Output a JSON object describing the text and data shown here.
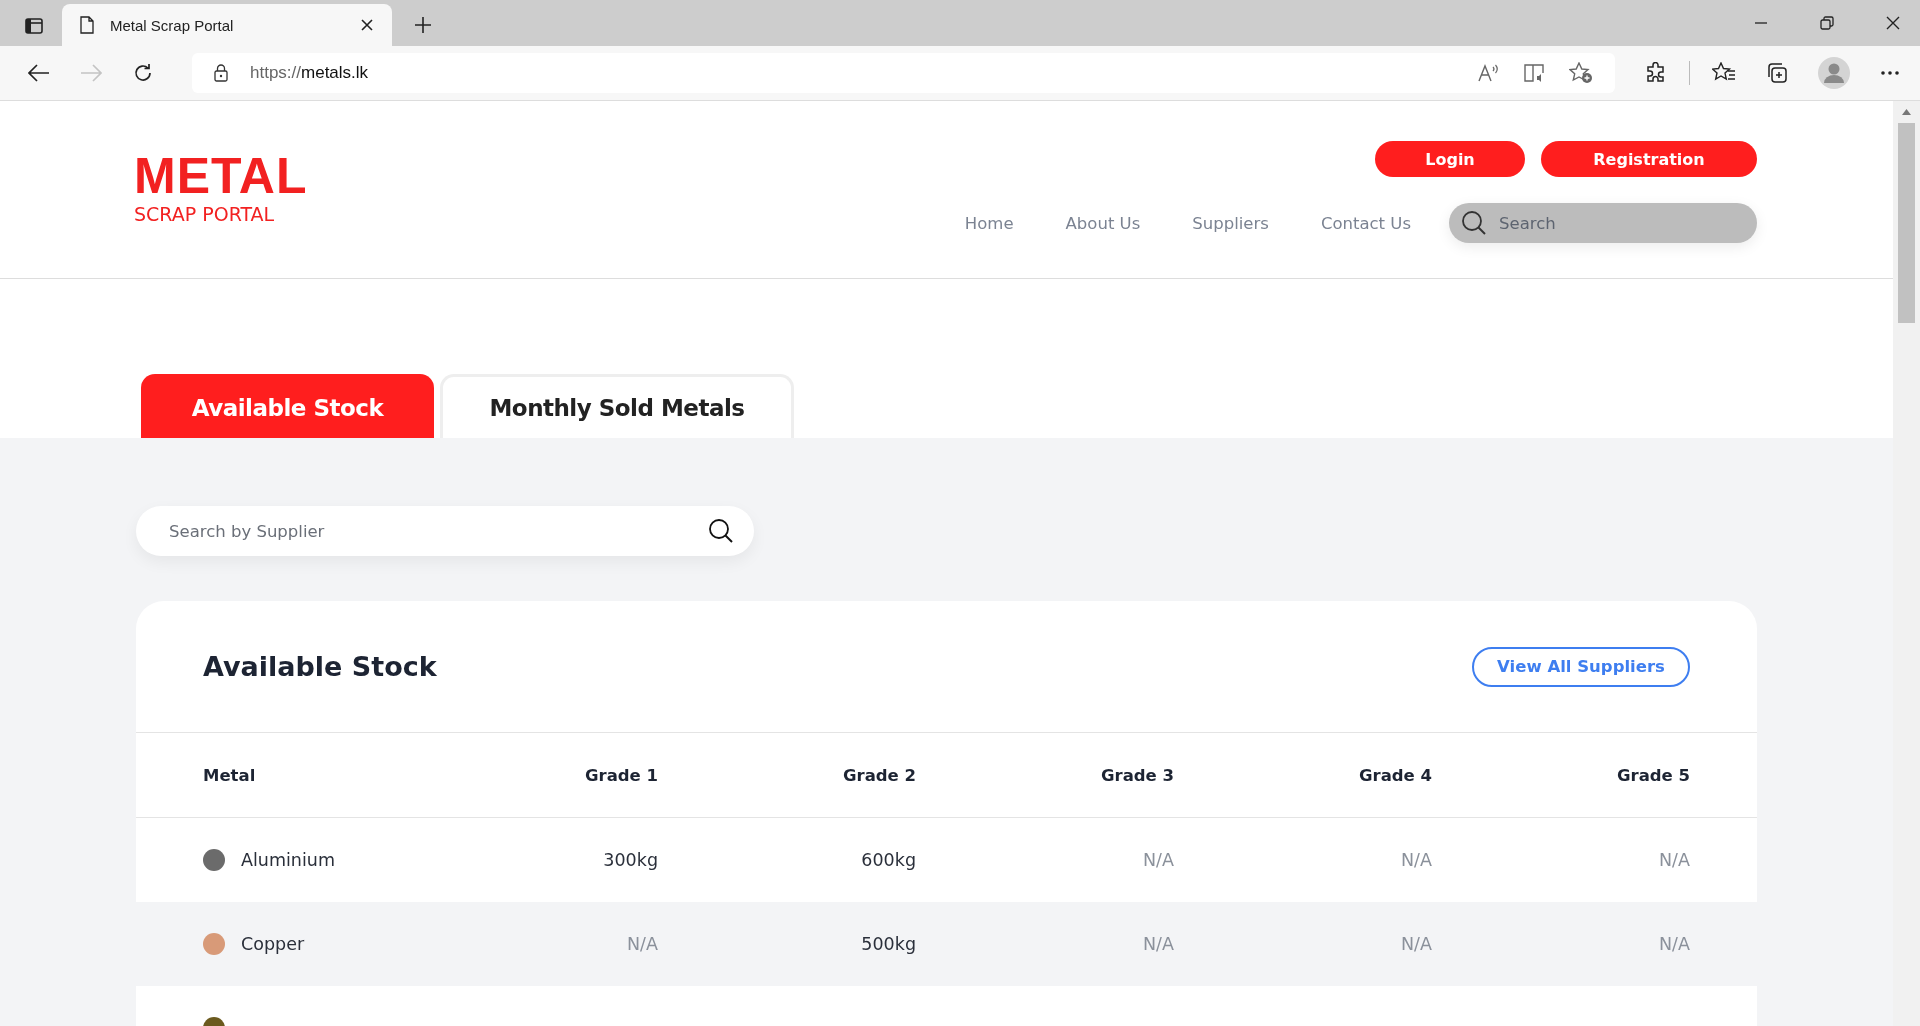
{
  "browser": {
    "tab_title": "Metal Scrap Portal",
    "url_scheme": "https://",
    "url_host": "metals.lk"
  },
  "logo": {
    "title": "METAL",
    "subtitle": "SCRAP PORTAL"
  },
  "auth_buttons": [
    "Login",
    "Registration"
  ],
  "nav": [
    "Home",
    "About Us",
    "Suppliers",
    "Contact Us"
  ],
  "site_search": {
    "placeholder": "Search"
  },
  "tabs": [
    {
      "label": "Available Stock",
      "selected": true
    },
    {
      "label": "Monthly Sold Metals",
      "selected": false
    }
  ],
  "supplier_search": {
    "placeholder": "Search by Supplier"
  },
  "card": {
    "title": "Available Stock",
    "action": "View All Suppliers"
  },
  "table": {
    "columns": [
      "Metal",
      "Grade 1",
      "Grade 2",
      "Grade 3",
      "Grade 4",
      "Grade 5"
    ],
    "rows": [
      {
        "color": "#6b6b6b",
        "cells": [
          "Aluminium",
          "300kg",
          "600kg",
          "N/A",
          "N/A",
          "N/A"
        ]
      },
      {
        "color": "#d89a78",
        "cells": [
          "Copper",
          "N/A",
          "500kg",
          "N/A",
          "N/A",
          "N/A"
        ]
      },
      {
        "color": "#6b5a1e",
        "cells": []
      }
    ]
  }
}
